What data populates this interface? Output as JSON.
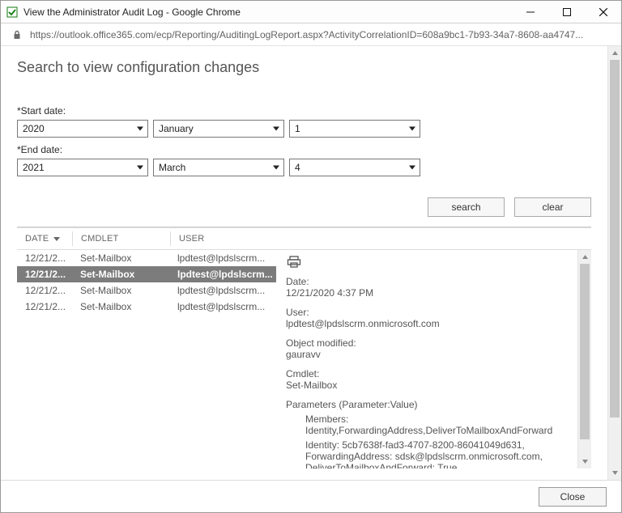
{
  "window": {
    "title": "View the Administrator Audit Log - Google Chrome",
    "url": "https://outlook.office365.com/ecp/Reporting/AuditingLogReport.aspx?ActivityCorrelationID=608a9bc1-7b93-34a7-8608-aa4747..."
  },
  "page": {
    "heading": "Search to view configuration changes",
    "start_date_label": "*Start date:",
    "end_date_label": "*End date:",
    "start": {
      "year": "2020",
      "month": "January",
      "day": "1"
    },
    "end": {
      "year": "2021",
      "month": "March",
      "day": "4"
    },
    "buttons": {
      "search": "search",
      "clear": "clear"
    }
  },
  "table": {
    "headers": {
      "date": "DATE",
      "cmd": "CMDLET",
      "user": "USER"
    },
    "rows": [
      {
        "date": "12/21/2...",
        "cmd": "Set-Mailbox",
        "user": "lpdtest@lpdslscrm...",
        "selected": false
      },
      {
        "date": "12/21/2...",
        "cmd": "Set-Mailbox",
        "user": "lpdtest@lpdslscrm...",
        "selected": true
      },
      {
        "date": "12/21/2...",
        "cmd": "Set-Mailbox",
        "user": "lpdtest@lpdslscrm...",
        "selected": false
      },
      {
        "date": "12/21/2...",
        "cmd": "Set-Mailbox",
        "user": "lpdtest@lpdslscrm...",
        "selected": false
      }
    ]
  },
  "detail": {
    "date_label": "Date:",
    "date_value": "12/21/2020 4:37 PM",
    "user_label": "User:",
    "user_value": "lpdtest@lpdslscrm.onmicrosoft.com",
    "object_label": "Object modified:",
    "object_value": "gauravv",
    "cmdlet_label": "Cmdlet:",
    "cmdlet_value": "Set-Mailbox",
    "params_label": "Parameters (Parameter:Value)",
    "params_lines": [
      "Members: Identity,ForwardingAddress,DeliverToMailboxAndForward",
      "Identity: 5cb7638f-fad3-4707-8200-86041049d631, ForwardingAddress: sdsk@lpdslscrm.onmicrosoft.com, DeliverToMailboxAndForward: True"
    ]
  },
  "footer": {
    "close": "Close"
  }
}
